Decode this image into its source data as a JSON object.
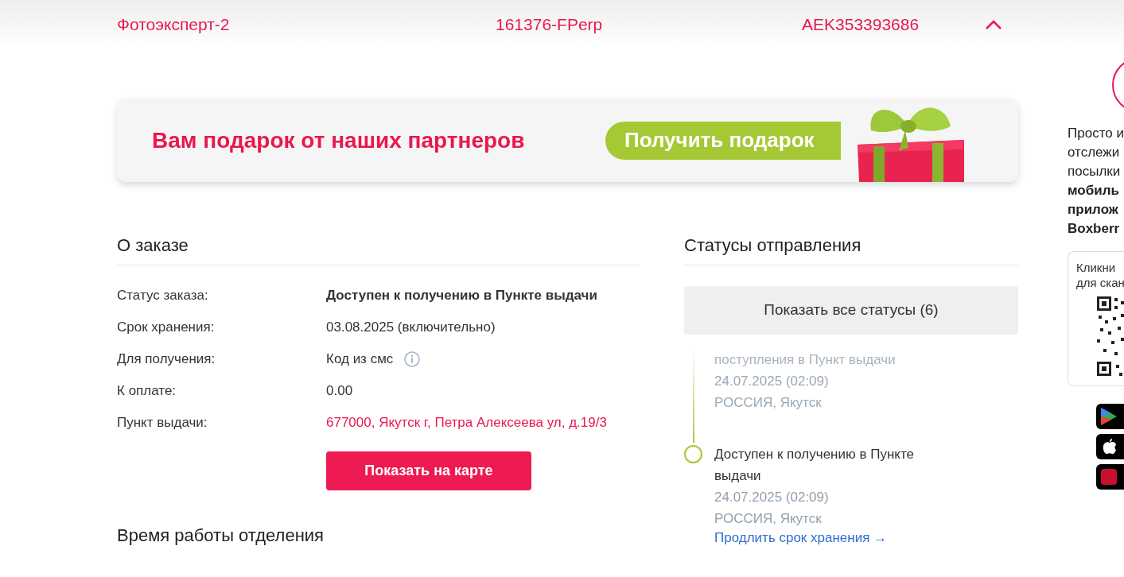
{
  "header": {
    "cells": [
      "Фотоэксперт-2",
      "161376-FPerp",
      "AEK353393686"
    ],
    "expanded": true
  },
  "banner": {
    "title": "Вам подарок от наших партнеров",
    "button": "Получить подарок"
  },
  "order": {
    "title": "О заказе",
    "fields": [
      {
        "label": "Статус заказа:",
        "value": "Доступен к получению в Пункте выдачи",
        "kind": "bold"
      },
      {
        "label": "Срок хранения:",
        "value": "03.08.2025 (включительно)",
        "kind": "plain"
      },
      {
        "label": "Для получения:",
        "value": "Код из смс",
        "kind": "info"
      },
      {
        "label": "К оплате:",
        "value": "0.00",
        "kind": "plain"
      },
      {
        "label": "Пункт выдачи:",
        "value": "677000, Якутск г, Петра Алексеева ул, д.19/3",
        "kind": "link"
      }
    ],
    "map_button": "Показать на карте",
    "hours_title": "Время работы отделения"
  },
  "statuses": {
    "title": "Статусы отправления",
    "show_all_button": "Показать все статусы (6)",
    "events": [
      {
        "title": "поступления в Пункт выдачи",
        "date": "24.07.2025 (02:09)",
        "place": "РОССИЯ, Якутск",
        "faded": true
      },
      {
        "title": "Доступен к получению в Пункте выдачи",
        "date": "24.07.2025 (02:09)",
        "place": "РОССИЯ, Якутск",
        "faded": false
      }
    ],
    "extend_link": "Продлить срок хранения →"
  },
  "promo": {
    "lines": [
      {
        "text": "Просто и",
        "bold": false
      },
      {
        "text": "отслежи",
        "bold": false
      },
      {
        "text": "посылки",
        "bold": false
      },
      {
        "text": "мобиль",
        "bold": true
      },
      {
        "text": "прилож",
        "bold": true
      },
      {
        "text": "Boxberr",
        "bold": true
      }
    ],
    "qr_caption": [
      "Кликни",
      "для скан"
    ]
  }
}
